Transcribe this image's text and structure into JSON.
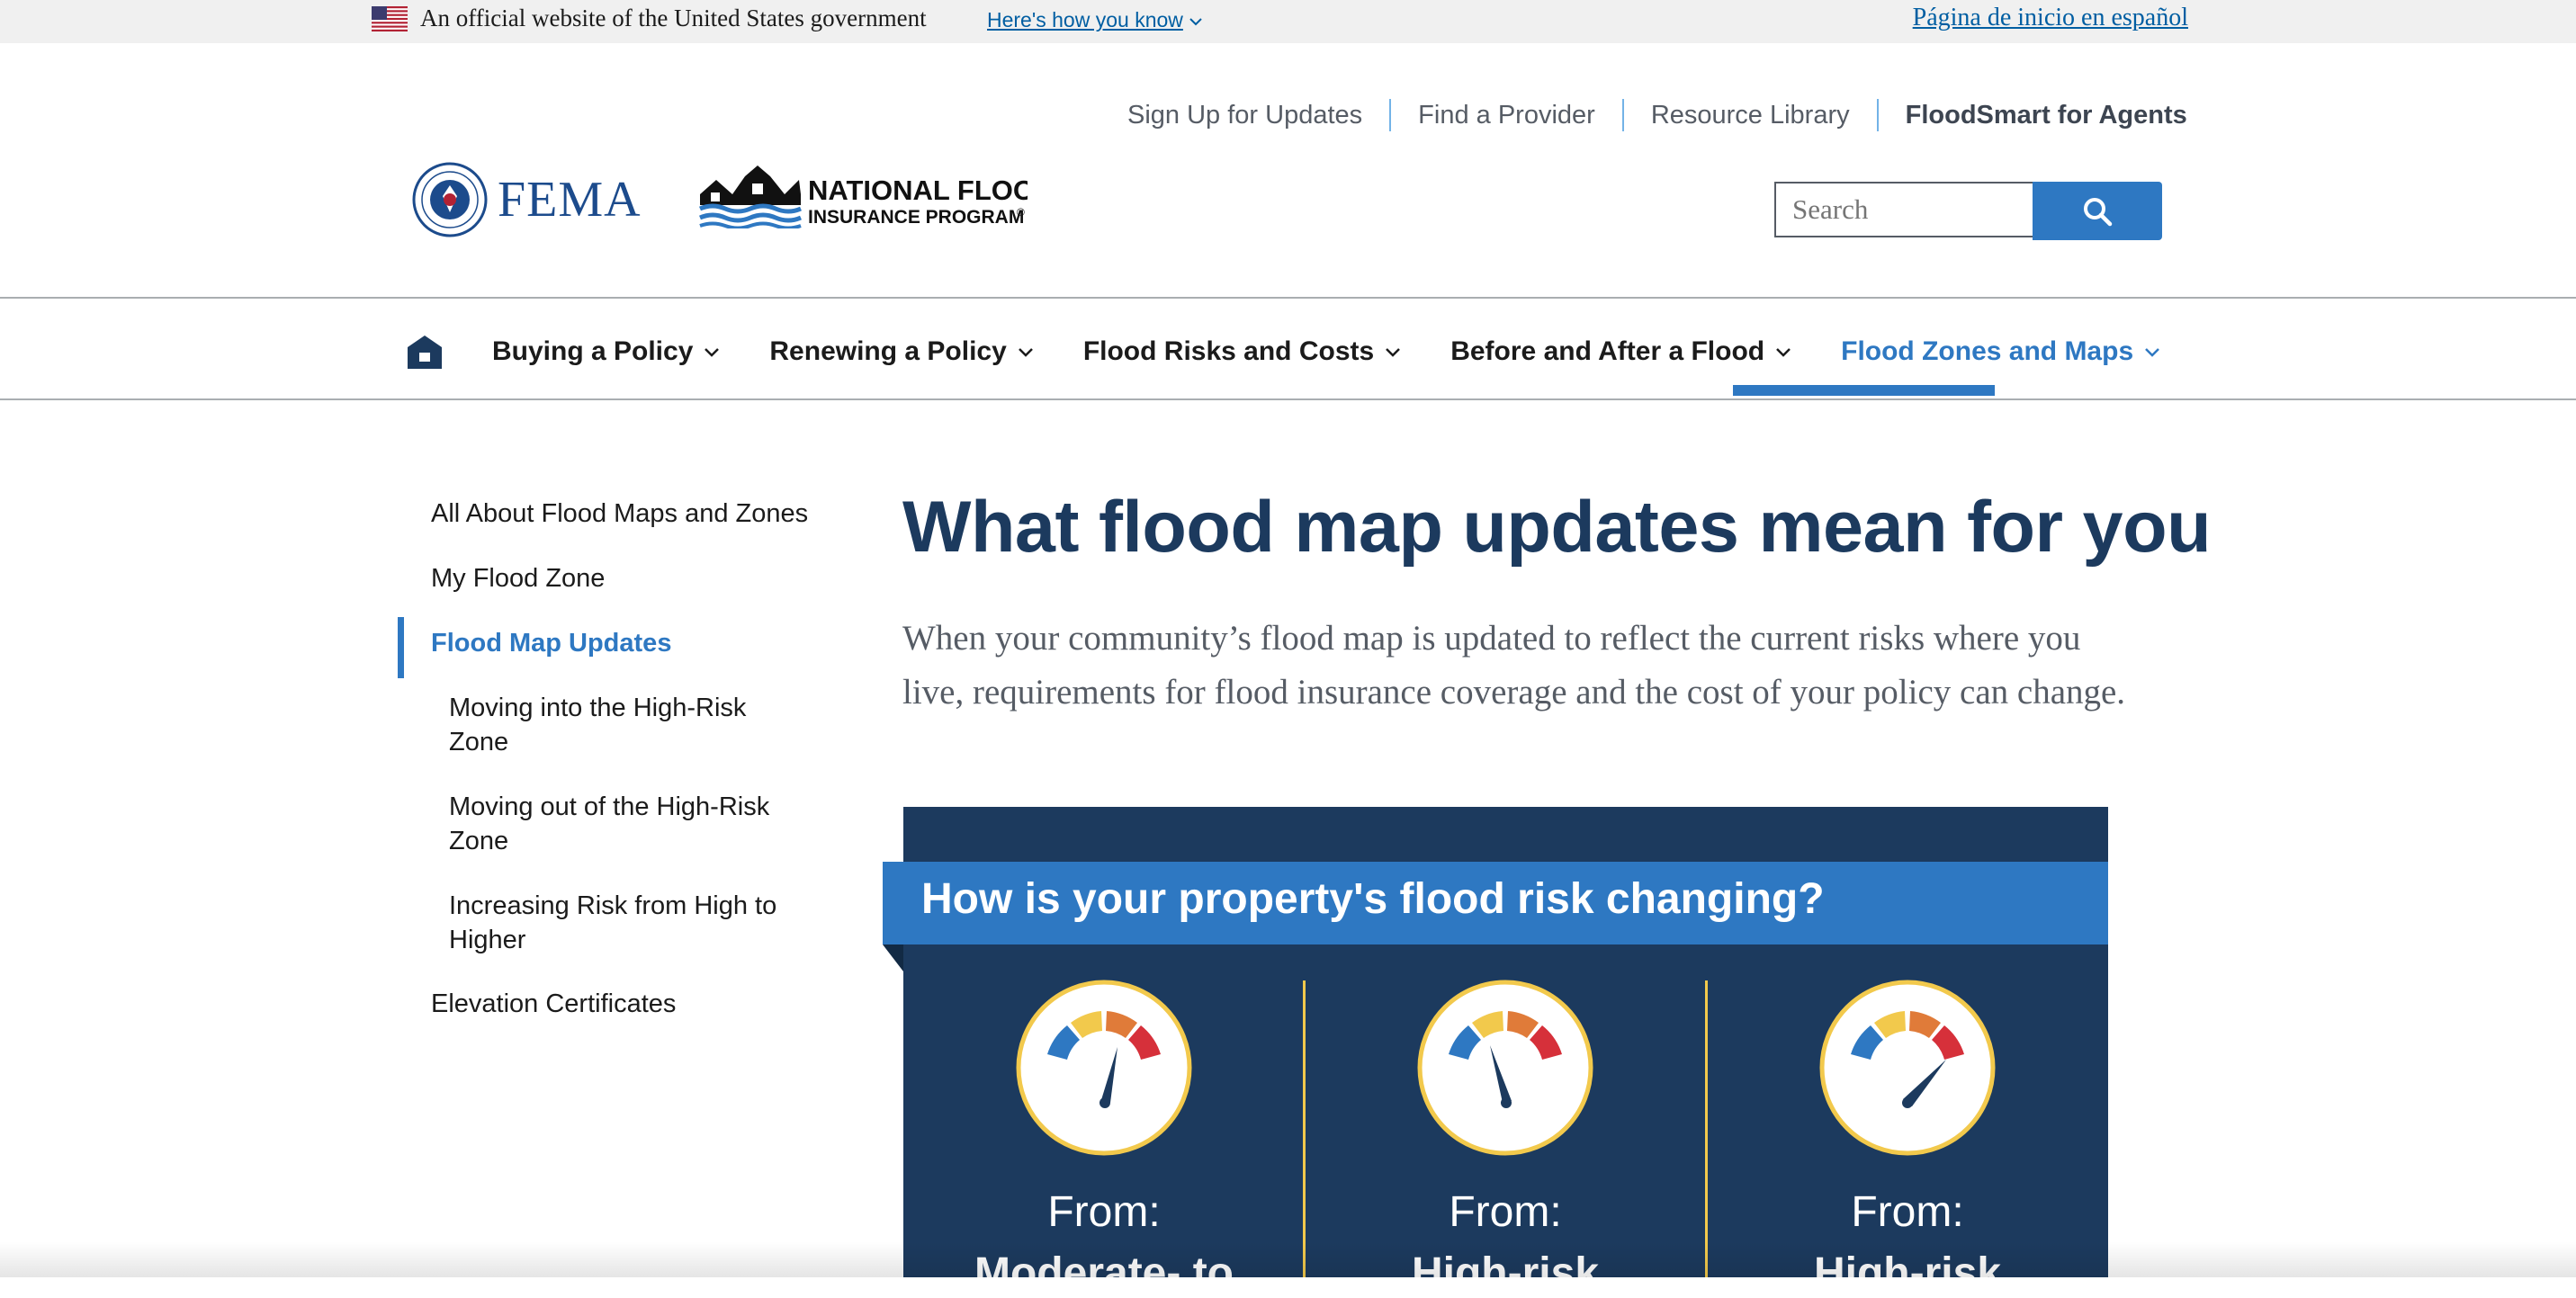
{
  "gov_banner": {
    "official_text": "An official website of the United States government",
    "how_you_know": "Here's how you know",
    "spanish_link": "Página de inicio en español"
  },
  "utility_nav": {
    "items": [
      "Sign Up for Updates",
      "Find a Provider",
      "Resource Library",
      "FloodSmart for Agents"
    ]
  },
  "logos": {
    "fema": "FEMA",
    "nfip_line1": "NATIONAL FLOOD",
    "nfip_line2": "INSURANCE PROGRAM",
    "nfip_reg": "®"
  },
  "search": {
    "placeholder": "Search"
  },
  "main_nav": {
    "items": [
      "Buying a Policy",
      "Renewing a Policy",
      "Flood Risks and Costs",
      "Before and After a Flood",
      "Flood Zones and Maps"
    ],
    "active": "Flood Zones and Maps"
  },
  "sidenav": {
    "items": [
      "All About Flood Maps and Zones",
      "My Flood Zone",
      "Flood Map Updates",
      "Moving into the High-Risk Zone",
      "Moving out of the High-Risk Zone",
      "Increasing Risk from High to Higher",
      "Elevation Certificates"
    ],
    "active": "Flood Map Updates"
  },
  "main": {
    "title": "What flood map updates mean for you",
    "intro": "When your community’s flood map is updated to reflect the current risks where you live, requirements for flood insurance coverage and the cost of your policy can change.",
    "card": {
      "heading": "How is your property's flood risk changing?",
      "columns": [
        {
          "from_label": "From:",
          "from_value": "Moderate- to"
        },
        {
          "from_label": "From:",
          "from_value": "High-risk"
        },
        {
          "from_label": "From:",
          "from_value": "High-risk"
        }
      ]
    }
  },
  "colors": {
    "primary_blue": "#2e78c2",
    "navy": "#1c3a5e",
    "link_blue": "#005ea2",
    "gauge_yellow": "#f2c94c"
  }
}
